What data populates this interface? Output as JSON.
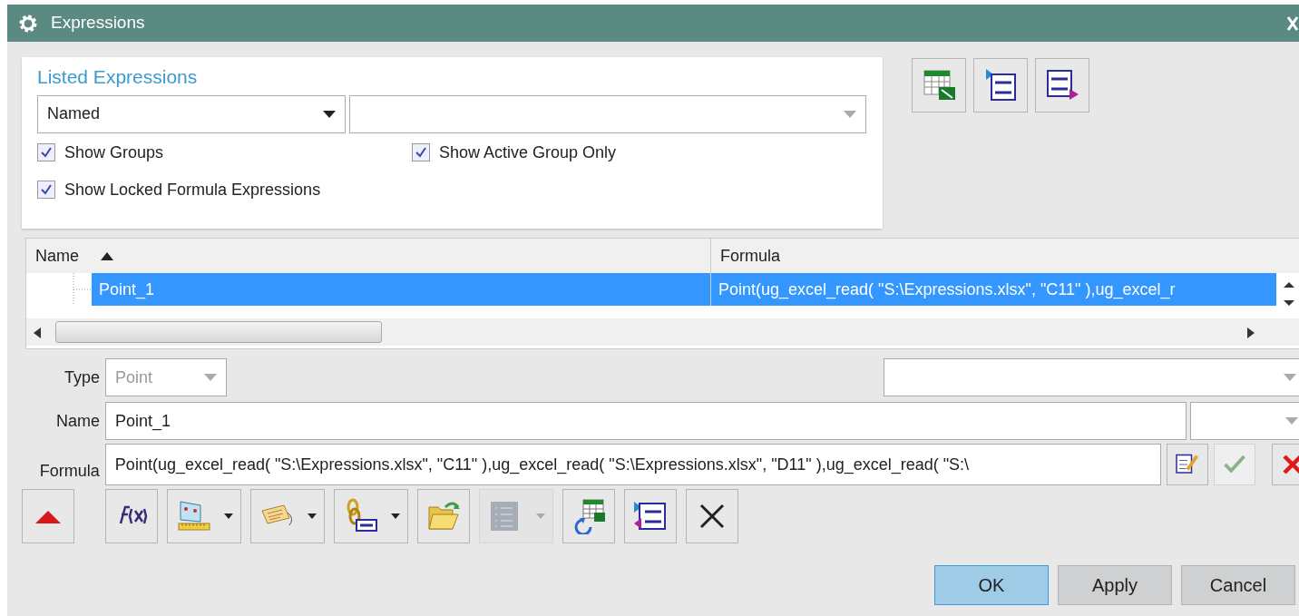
{
  "window": {
    "title": "Expressions"
  },
  "listed_expressions": {
    "title": "Listed Expressions",
    "filter": {
      "value": "Named"
    },
    "checkboxes": [
      {
        "label": "Show Groups",
        "checked": true
      },
      {
        "label": "Show Active Group Only",
        "checked": true
      },
      {
        "label": "Show Locked Formula Expressions",
        "checked": true
      }
    ]
  },
  "top_tools": [
    {
      "kind": "spreadsheet"
    },
    {
      "kind": "import"
    },
    {
      "kind": "export"
    }
  ],
  "table": {
    "columns": [
      {
        "label": "Name",
        "sorted": true
      },
      {
        "label": "Formula",
        "sorted": false
      }
    ],
    "rows": [
      {
        "name": "Point_1",
        "formula": "Point(ug_excel_read( \"S:\\Expressions.xlsx\", \"C11\" ),ug_excel_r",
        "selected": true
      }
    ]
  },
  "editor": {
    "type": {
      "label": "Type",
      "value": "Point",
      "disabled": true
    },
    "name": {
      "label": "Name",
      "value": "Point_1"
    },
    "formula": {
      "label": "Formula",
      "value": "Point(ug_excel_read( \"S:\\Expressions.xlsx\", \"C11\" ),ug_excel_read( \"S:\\Expressions.xlsx\", \"D11\" ),ug_excel_read( \"S:\\"
    }
  },
  "formula_tools": [
    {
      "kind": "edit",
      "disabled": false
    },
    {
      "kind": "accept",
      "disabled": true
    },
    {
      "kind": "reject",
      "disabled": false
    }
  ],
  "toolbar": [
    {
      "kind": "collapse",
      "dropdown": false,
      "disabled": false
    },
    {
      "kind": "function",
      "dropdown": false,
      "disabled": false
    },
    {
      "kind": "measure",
      "dropdown": true,
      "disabled": false
    },
    {
      "kind": "tag",
      "dropdown": true,
      "disabled": false
    },
    {
      "kind": "link",
      "dropdown": true,
      "disabled": false
    },
    {
      "kind": "folder",
      "dropdown": false,
      "disabled": false
    },
    {
      "kind": "list",
      "dropdown": true,
      "disabled": true
    },
    {
      "kind": "refresh-sheet",
      "dropdown": false,
      "disabled": false
    },
    {
      "kind": "swap",
      "dropdown": false,
      "disabled": false
    },
    {
      "kind": "delete",
      "dropdown": false,
      "disabled": false
    }
  ],
  "dialog_buttons": [
    {
      "label": "OK",
      "default": true
    },
    {
      "label": "Apply",
      "default": false
    },
    {
      "label": "Cancel",
      "default": false
    }
  ]
}
